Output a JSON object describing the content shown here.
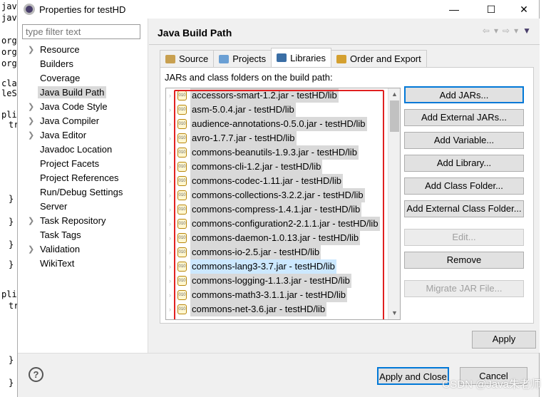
{
  "editor_fragments": [
    "jav",
    "jav",
    "org",
    "org",
    "org",
    "cla",
    "leSy",
    "plic",
    "tr",
    "}",
    "}",
    "}",
    "}",
    "plic",
    "tr",
    "}",
    "}"
  ],
  "window": {
    "title": "Properties for testHD",
    "minimize": "—",
    "maximize": "☐",
    "close": "✕"
  },
  "filter": {
    "placeholder": "type filter text"
  },
  "tree": [
    {
      "label": "Resource",
      "expandable": true
    },
    {
      "label": "Builders",
      "expandable": false
    },
    {
      "label": "Coverage",
      "expandable": false
    },
    {
      "label": "Java Build Path",
      "expandable": false,
      "selected": true
    },
    {
      "label": "Java Code Style",
      "expandable": true
    },
    {
      "label": "Java Compiler",
      "expandable": true
    },
    {
      "label": "Java Editor",
      "expandable": true
    },
    {
      "label": "Javadoc Location",
      "expandable": false
    },
    {
      "label": "Project Facets",
      "expandable": false
    },
    {
      "label": "Project References",
      "expandable": false
    },
    {
      "label": "Run/Debug Settings",
      "expandable": false
    },
    {
      "label": "Server",
      "expandable": false
    },
    {
      "label": "Task Repository",
      "expandable": true
    },
    {
      "label": "Task Tags",
      "expandable": false
    },
    {
      "label": "Validation",
      "expandable": true
    },
    {
      "label": "WikiText",
      "expandable": false
    }
  ],
  "page_title": "Java Build Path",
  "tabs": [
    {
      "label": "Source",
      "color": "#c8a050"
    },
    {
      "label": "Projects",
      "color": "#6a9fd4"
    },
    {
      "label": "Libraries",
      "color": "#3a6ea5",
      "active": true
    },
    {
      "label": "Order and Export",
      "color": "#d4a030"
    }
  ],
  "panel_label": "JARs and class folders on the build path:",
  "jars": [
    "accessors-smart-1.2.jar - testHD/lib",
    "asm-5.0.4.jar - testHD/lib",
    "audience-annotations-0.5.0.jar - testHD/lib",
    "avro-1.7.7.jar - testHD/lib",
    "commons-beanutils-1.9.3.jar - testHD/lib",
    "commons-cli-1.2.jar - testHD/lib",
    "commons-codec-1.11.jar - testHD/lib",
    "commons-collections-3.2.2.jar - testHD/lib",
    "commons-compress-1.4.1.jar - testHD/lib",
    "commons-configuration2-2.1.1.jar - testHD/lib",
    "commons-daemon-1.0.13.jar - testHD/lib",
    "commons-io-2.5.jar - testHD/lib",
    "commons-lang3-3.7.jar - testHD/lib",
    "commons-logging-1.1.3.jar - testHD/lib",
    "commons-math3-3.1.1.jar - testHD/lib",
    "commons-net-3.6.jar - testHD/lib"
  ],
  "highlighted_jar_index": 12,
  "jar_icon_text": "010",
  "buttons": [
    {
      "label": "Add JARs...",
      "default": true
    },
    {
      "label": "Add External JARs..."
    },
    {
      "label": "Add Variable..."
    },
    {
      "label": "Add Library..."
    },
    {
      "label": "Add Class Folder..."
    },
    {
      "label": "Add External Class Folder..."
    },
    {
      "label": "Edit...",
      "disabled": true
    },
    {
      "label": "Remove"
    },
    {
      "label": "Migrate JAR File...",
      "disabled": true
    }
  ],
  "apply": "Apply",
  "apply_close": "Apply and Close",
  "cancel": "Cancel",
  "help": "?",
  "watermark": "CSDN @Java朱老师",
  "highlight_color": "#e02020"
}
